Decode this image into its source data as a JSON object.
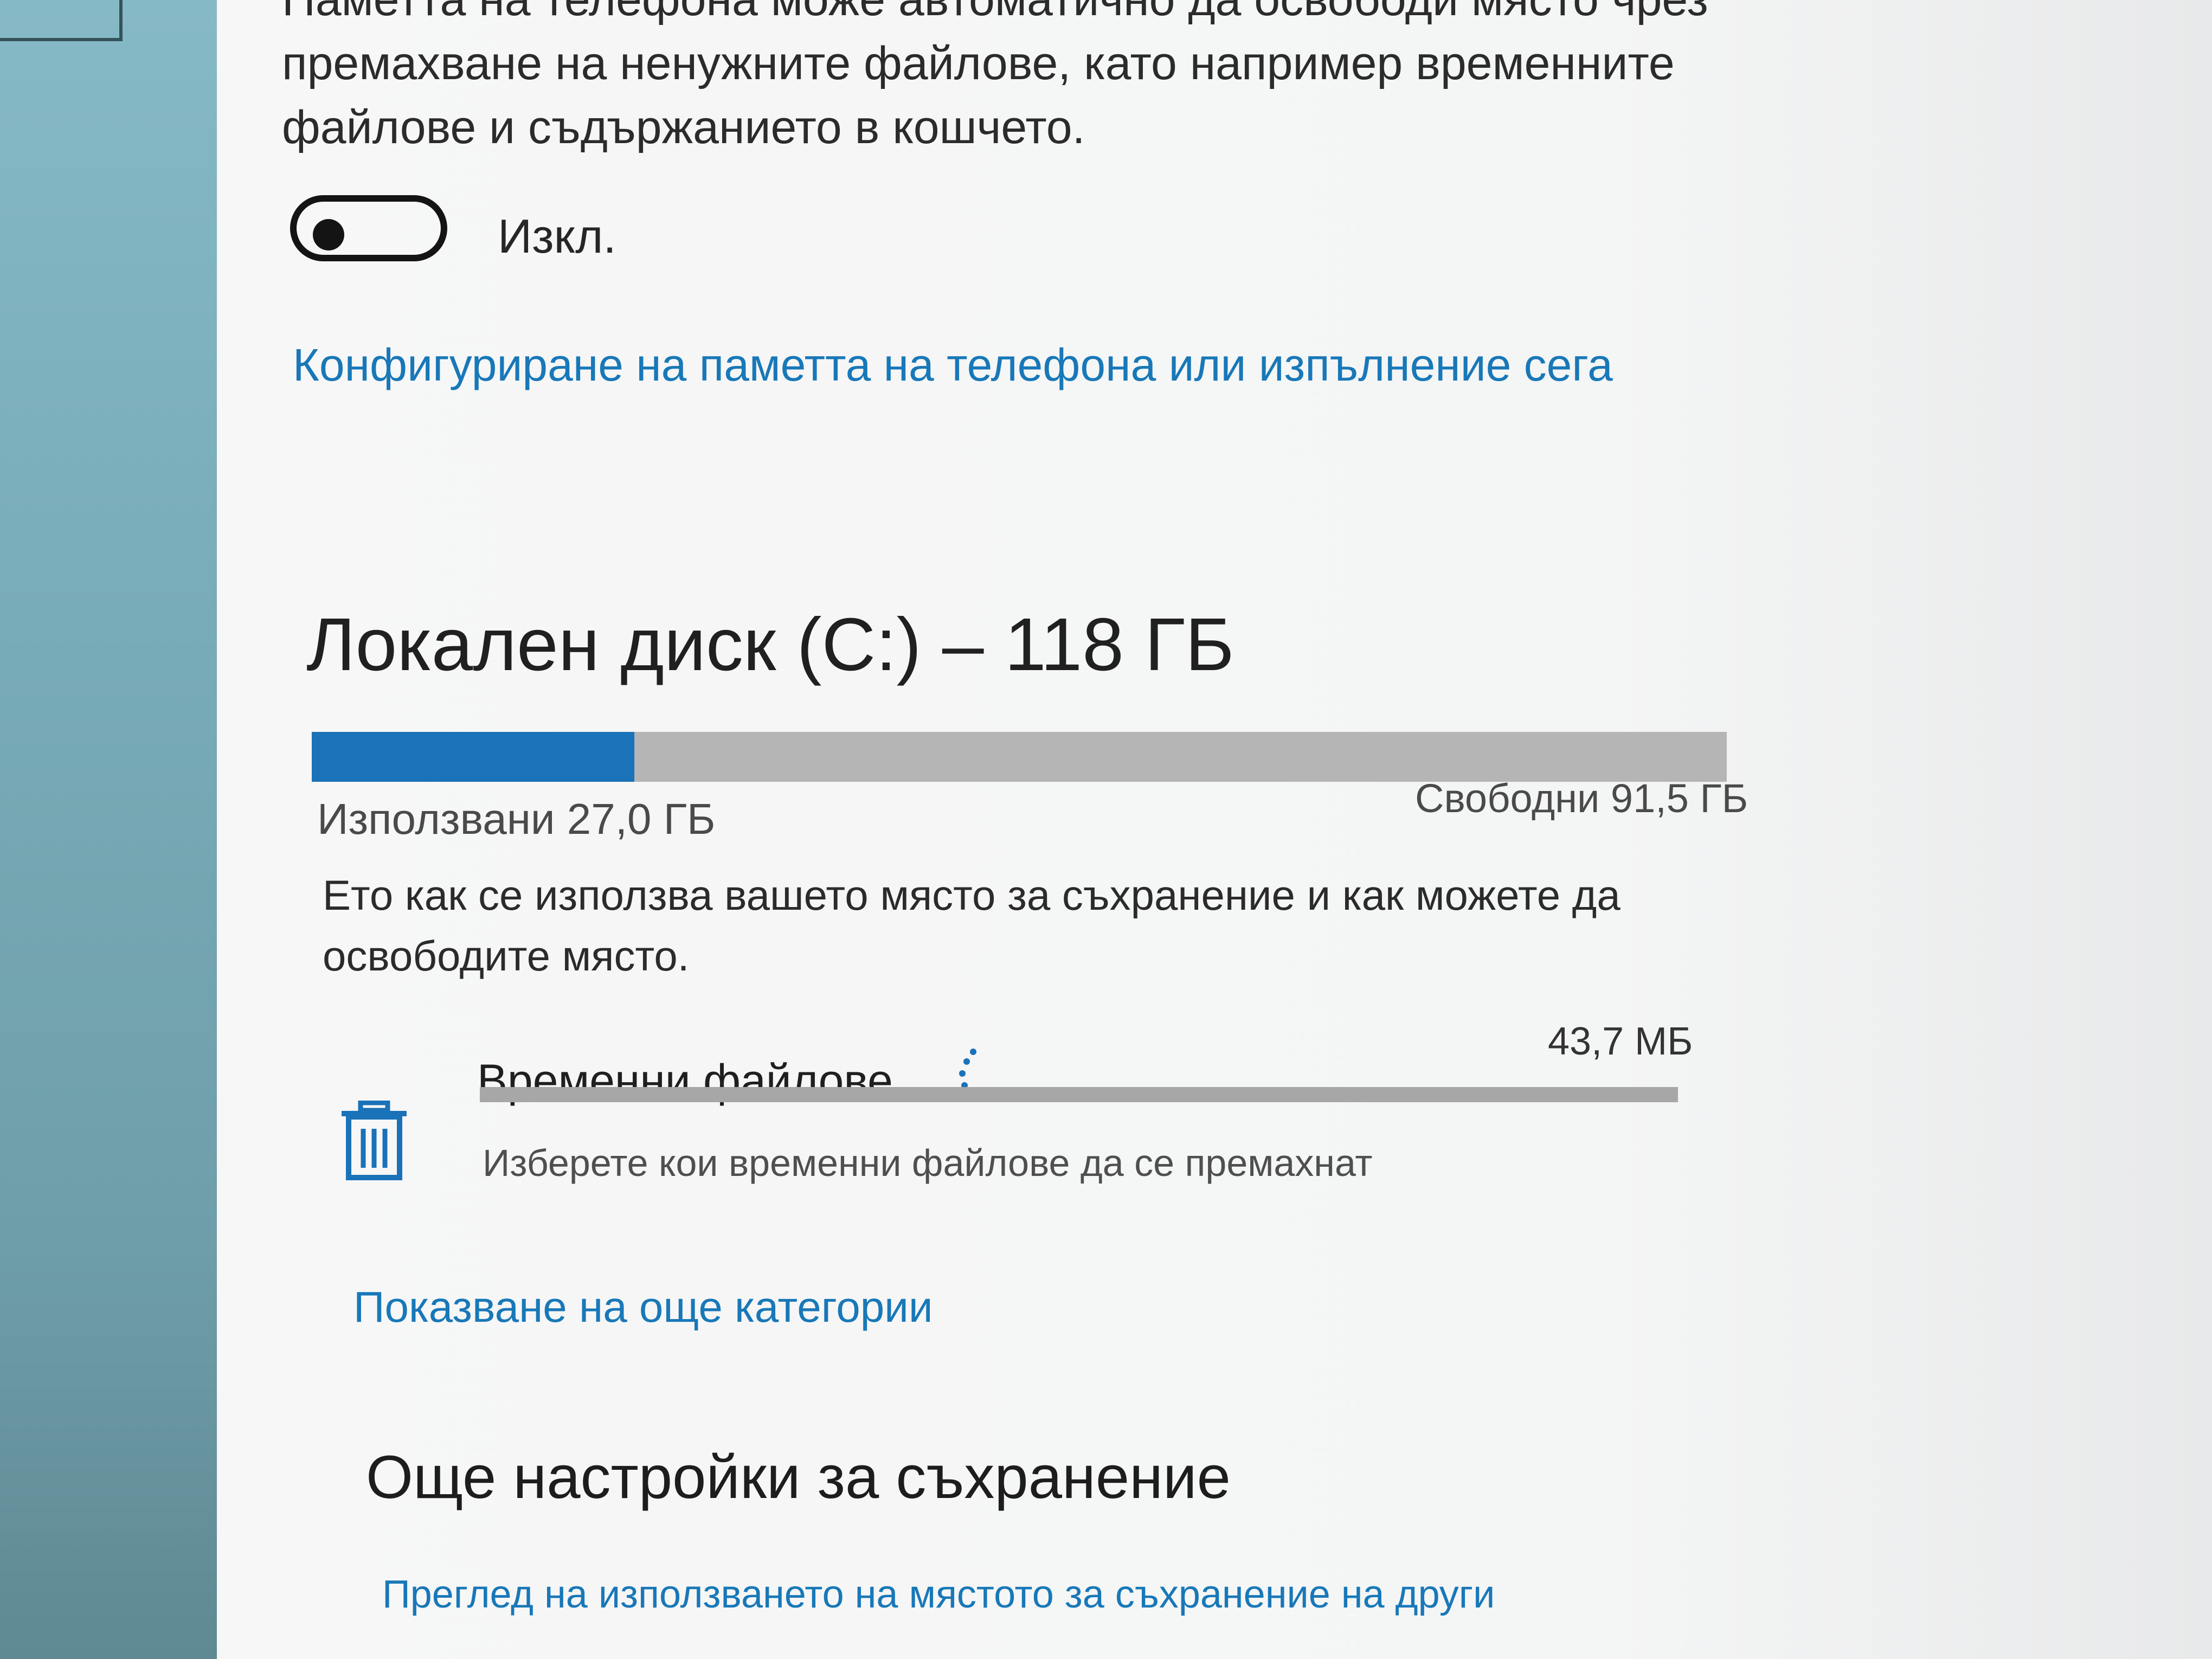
{
  "storage_sense": {
    "description": "Паметта на телефона може автоматично да освободи място чрез премахване на ненужните файлове, като например временните файлове и съдържанието в кошчето.",
    "toggle_label": "Изкл.",
    "toggle_on": false,
    "configure_link": "Конфигуриране на паметта на телефона или изпълнение сега"
  },
  "drive": {
    "title": "Локален диск (C:) – 118 ГБ",
    "used_label": "Използвани 27,0 ГБ",
    "free_label": "Свободни 91,5 ГБ",
    "used_fraction": 0.228,
    "bar_color": "#1a72b8",
    "info_text": "Ето как се използва вашето място за съхранение и как можете да освободите място."
  },
  "categories": [
    {
      "icon": "trash-icon",
      "name": "Временни файлове",
      "size": "43,7 МБ",
      "subtitle": "Изберете кои временни файлове да се премахнат",
      "used_fraction": 0.0
    }
  ],
  "show_more_link": "Показване на още категории",
  "more_settings": {
    "title": "Още настройки за съхранение",
    "link": "Преглед на използването на мястото за съхранение на други"
  },
  "colors": {
    "accent": "#1878b8",
    "sidebar": "#7fb2bf"
  }
}
